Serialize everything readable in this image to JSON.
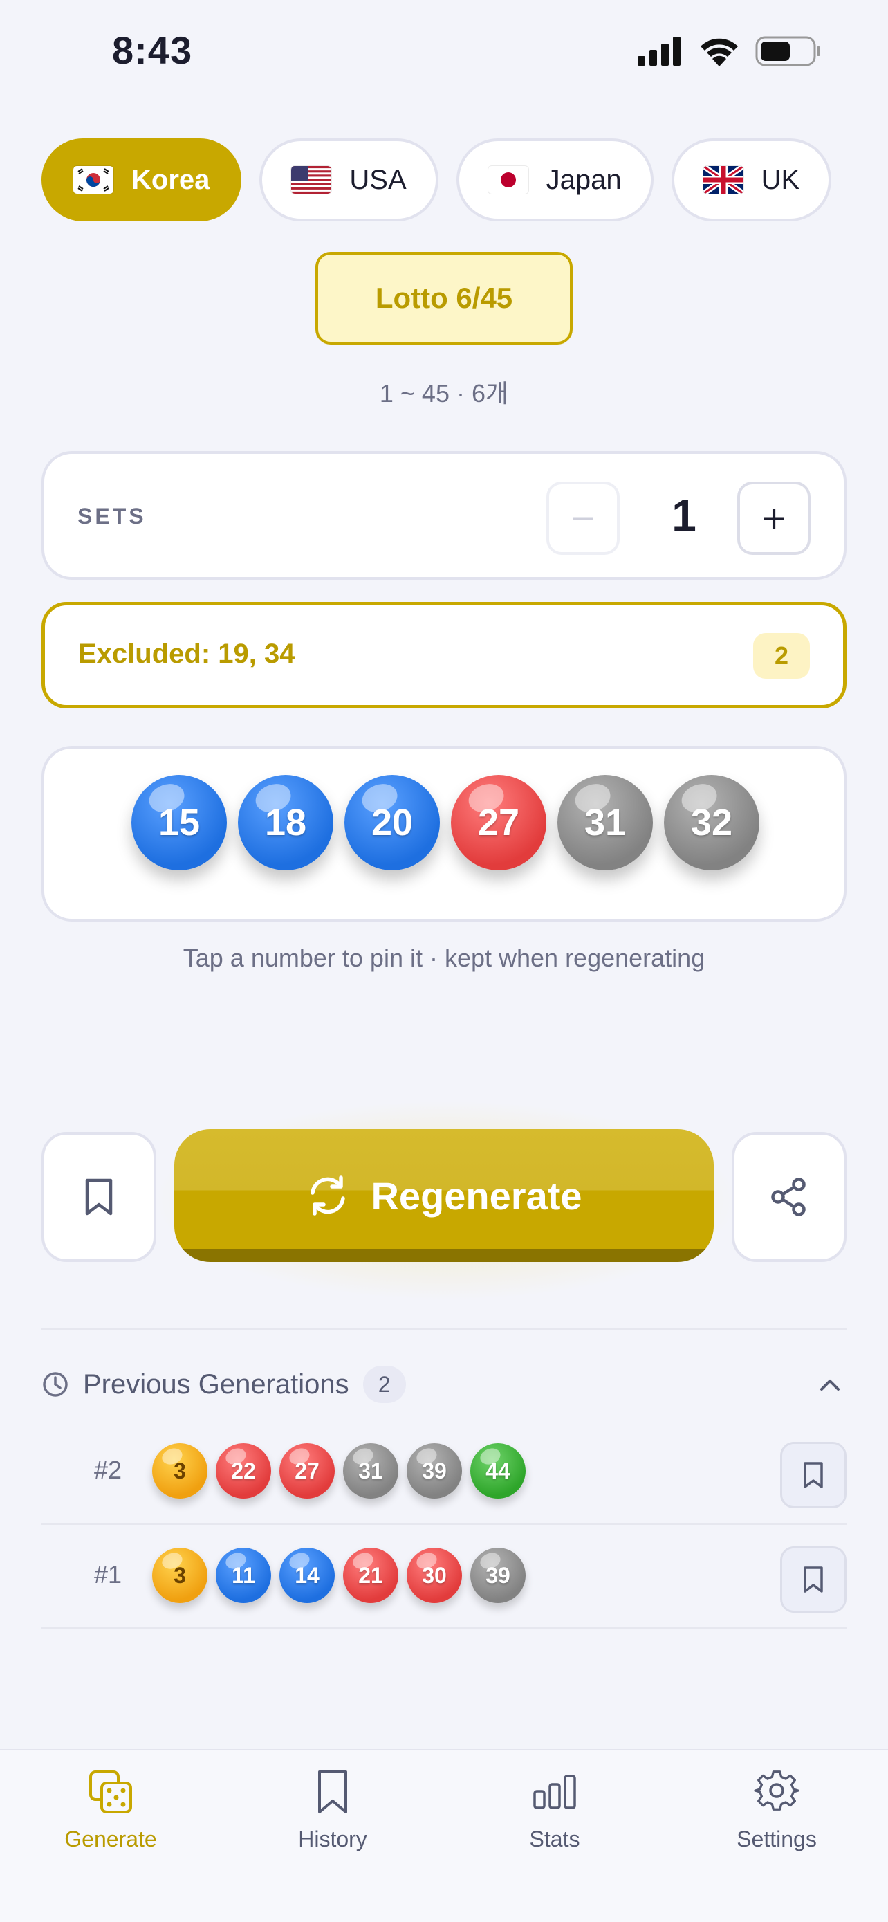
{
  "status_bar": {
    "time": "8:43"
  },
  "countries": [
    {
      "label": "Korea",
      "flag": "kr-flag",
      "active": true
    },
    {
      "label": "USA",
      "flag": "us-flag",
      "active": false
    },
    {
      "label": "Japan",
      "flag": "jp-flag",
      "active": false
    },
    {
      "label": "UK",
      "flag": "uk-flag",
      "active": false
    }
  ],
  "game": {
    "name": "Lotto 6/45",
    "range": "1 ~ 45 · 6개"
  },
  "sets": {
    "label": "SETS",
    "value": "1",
    "minus": "−",
    "plus": "+"
  },
  "excluded": {
    "text": "Excluded: 19, 34",
    "count": "2"
  },
  "current_numbers": [
    {
      "n": "15",
      "color": "blue"
    },
    {
      "n": "18",
      "color": "blue"
    },
    {
      "n": "20",
      "color": "blue"
    },
    {
      "n": "27",
      "color": "red"
    },
    {
      "n": "31",
      "color": "gray"
    },
    {
      "n": "32",
      "color": "gray"
    }
  ],
  "pin_hint": "Tap a number to pin it · kept when regenerating",
  "actions": {
    "regenerate_label": "Regenerate"
  },
  "history": {
    "title": "Previous Generations",
    "count": "2",
    "rows": [
      {
        "label": "#2",
        "numbers": [
          {
            "n": "3",
            "color": "yellow"
          },
          {
            "n": "22",
            "color": "red"
          },
          {
            "n": "27",
            "color": "red"
          },
          {
            "n": "31",
            "color": "gray"
          },
          {
            "n": "39",
            "color": "gray"
          },
          {
            "n": "44",
            "color": "green"
          }
        ]
      },
      {
        "label": "#1",
        "numbers": [
          {
            "n": "3",
            "color": "yellow"
          },
          {
            "n": "11",
            "color": "blue"
          },
          {
            "n": "14",
            "color": "blue"
          },
          {
            "n": "21",
            "color": "red"
          },
          {
            "n": "30",
            "color": "red"
          },
          {
            "n": "39",
            "color": "gray"
          }
        ]
      }
    ]
  },
  "tab_bar": [
    {
      "label": "Generate",
      "icon": "dice-icon",
      "active": true
    },
    {
      "label": "History",
      "icon": "bookmark-icon",
      "active": false
    },
    {
      "label": "Stats",
      "icon": "bar-chart-icon",
      "active": false
    },
    {
      "label": "Settings",
      "icon": "gear-icon",
      "active": false
    }
  ],
  "colors": {
    "accent": "#c8a800",
    "accent_light": "#fdf6c8",
    "background": "#f3f4fa"
  }
}
